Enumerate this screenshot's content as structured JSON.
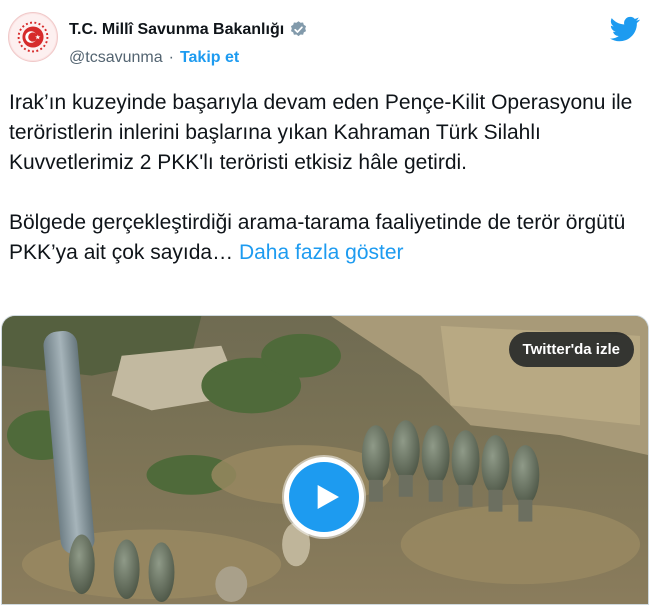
{
  "account": {
    "display_name": "T.C. Millî Savunma Bakanlığı",
    "handle": "@tcsavunma",
    "separator": "·",
    "follow_label": "Takip et",
    "verified_icon": "verified-badge-icon"
  },
  "tweet": {
    "paragraph_1": "Irak’ın kuzeyinde başarıyla devam eden Pençe-Kilit Operasyonu ile teröristlerin inlerini başlarına yıkan Kahraman Türk Silahlı Kuvvetlerimiz 2 PKK'lı teröristi etkisiz hâle getirdi.",
    "paragraph_2": "Bölgede gerçekleştirdiği arama-tarama faaliyetinde de terör örgütü PKK’ya ait çok sayıda…",
    "more_label": "Daha fazla göster"
  },
  "media": {
    "watch_label": "Twitter'da izle",
    "play_icon": "play-icon"
  },
  "colors": {
    "accent": "#1d9bf0",
    "text": "#0f1419",
    "secondary": "#536471"
  }
}
